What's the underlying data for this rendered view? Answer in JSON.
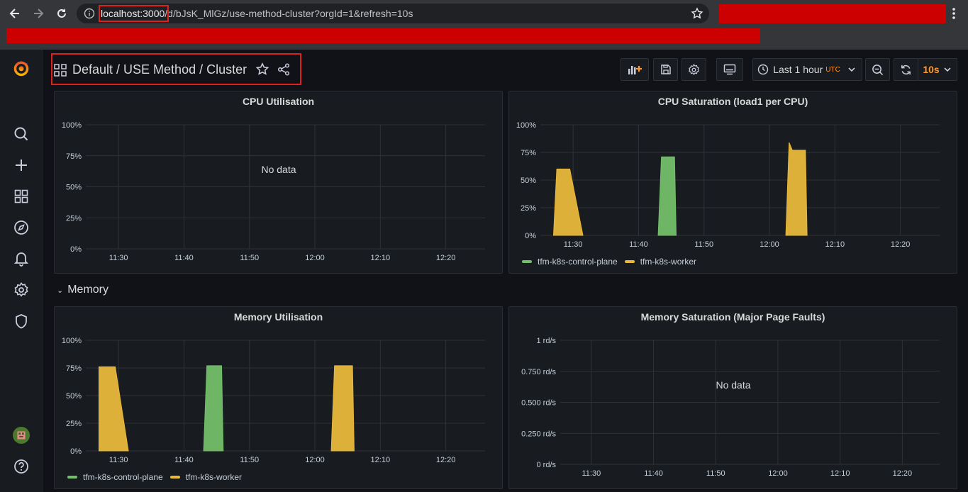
{
  "browser": {
    "url_host": "localhost:3000",
    "url_path": "/d/bJsK_MlGz/use-method-cluster?orgId=1&refresh=10s"
  },
  "dashboard": {
    "title": "Default / USE Method / Cluster"
  },
  "toolbar": {
    "time_range": "Last 1 hour",
    "timezone": "UTC",
    "refresh_interval": "10s"
  },
  "rows": {
    "memory": "Memory"
  },
  "colors": {
    "control_plane": "#73bf69",
    "worker": "#e8b83b",
    "accent": "#ff9830",
    "panel_bg": "#181b1f"
  },
  "time_ticks": [
    "11:30",
    "11:40",
    "11:50",
    "12:00",
    "12:10",
    "12:20"
  ],
  "panels": {
    "cpu_util": {
      "title": "CPU Utilisation",
      "no_data": "No data",
      "y_ticks": [
        "100%",
        "75%",
        "50%",
        "25%",
        "0%"
      ]
    },
    "cpu_sat": {
      "title": "CPU Saturation (load1 per CPU)",
      "y_ticks": [
        "100%",
        "75%",
        "50%",
        "25%",
        "0%"
      ],
      "legend": [
        "tfm-k8s-control-plane",
        "tfm-k8s-worker"
      ]
    },
    "mem_util": {
      "title": "Memory Utilisation",
      "y_ticks": [
        "100%",
        "75%",
        "50%",
        "25%",
        "0%"
      ],
      "legend": [
        "tfm-k8s-control-plane",
        "tfm-k8s-worker"
      ]
    },
    "mem_sat": {
      "title": "Memory Saturation (Major Page Faults)",
      "no_data": "No data",
      "y_ticks": [
        "1 rd/s",
        "0.750 rd/s",
        "0.500 rd/s",
        "0.250 rd/s",
        "0 rd/s"
      ]
    }
  },
  "chart_data": [
    {
      "type": "area",
      "title": "CPU Utilisation",
      "ylim": [
        0,
        100
      ],
      "yunit": "%",
      "x_range": [
        "11:25",
        "12:26"
      ],
      "series": []
    },
    {
      "type": "area",
      "title": "CPU Saturation (load1 per CPU)",
      "ylim": [
        0,
        100
      ],
      "yunit": "%",
      "x_range": [
        "11:25",
        "12:26"
      ],
      "series": [
        {
          "name": "tfm-k8s-worker",
          "color": "#e8b83b",
          "points": [
            [
              "11:27:00",
              0
            ],
            [
              "11:27:30",
              60
            ],
            [
              "11:29:30",
              60
            ],
            [
              "11:31:30",
              0
            ]
          ]
        },
        {
          "name": "tfm-k8s-control-plane",
          "color": "#73bf69",
          "points": [
            [
              "11:43:00",
              0
            ],
            [
              "11:43:30",
              71
            ],
            [
              "11:45:30",
              71
            ],
            [
              "11:45:45",
              0
            ]
          ]
        },
        {
          "name": "tfm-k8s-worker",
          "color": "#e8b83b",
          "points": [
            [
              "12:02:30",
              0
            ],
            [
              "12:03:00",
              84
            ],
            [
              "12:03:30",
              77
            ],
            [
              "12:05:30",
              77
            ],
            [
              "12:05:45",
              0
            ]
          ]
        }
      ]
    },
    {
      "type": "area",
      "title": "Memory Utilisation",
      "ylim": [
        0,
        100
      ],
      "yunit": "%",
      "x_range": [
        "11:25",
        "12:26"
      ],
      "series": [
        {
          "name": "tfm-k8s-worker",
          "color": "#e8b83b",
          "points": [
            [
              "11:27:00",
              0
            ],
            [
              "11:27:00",
              76
            ],
            [
              "11:29:30",
              76
            ],
            [
              "11:31:30",
              0
            ]
          ]
        },
        {
          "name": "tfm-k8s-control-plane",
          "color": "#73bf69",
          "points": [
            [
              "11:43:00",
              0
            ],
            [
              "11:43:30",
              77
            ],
            [
              "11:45:45",
              77
            ],
            [
              "11:46:00",
              0
            ]
          ]
        },
        {
          "name": "tfm-k8s-worker",
          "color": "#e8b83b",
          "points": [
            [
              "12:02:30",
              0
            ],
            [
              "12:03:00",
              77
            ],
            [
              "12:05:45",
              77
            ],
            [
              "12:06:00",
              0
            ]
          ]
        }
      ]
    },
    {
      "type": "area",
      "title": "Memory Saturation (Major Page Faults)",
      "ylim": [
        0,
        1
      ],
      "yunit": "rd/s",
      "x_range": [
        "11:25",
        "12:26"
      ],
      "series": []
    }
  ]
}
